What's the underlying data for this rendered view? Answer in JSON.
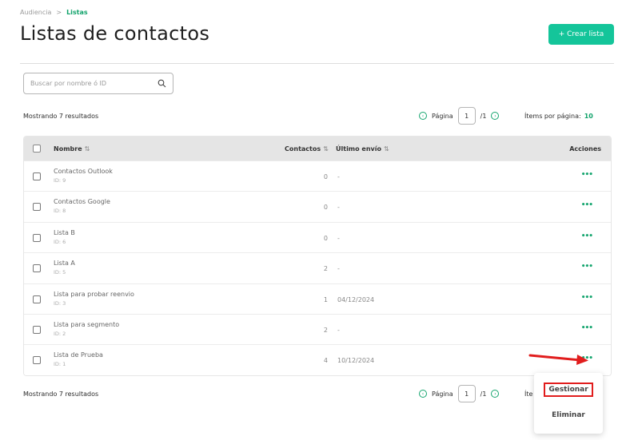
{
  "breadcrumb": {
    "parent": "Audiencia",
    "separator": ">",
    "current": "Listas"
  },
  "page_title": "Listas de contactos",
  "create_button": {
    "icon": "plus-icon",
    "label": "+  Crear lista"
  },
  "search": {
    "placeholder": "Buscar por nombre ó ID",
    "value": ""
  },
  "results_text": "Mostrando 7 resultados",
  "pagination": {
    "label": "Página",
    "current": "1",
    "total": "/1",
    "per_page_label": "Ítems por página:",
    "per_page": "10"
  },
  "table": {
    "columns": {
      "name": "Nombre",
      "contacts": "Contactos",
      "last_send": "Último envío",
      "actions": "Acciones",
      "sort_icon": "⇅"
    },
    "rows": [
      {
        "name": "Contactos Outlook",
        "id": "ID: 9",
        "contacts": "0",
        "last": "-"
      },
      {
        "name": "Contactos Google",
        "id": "ID: 8",
        "contacts": "0",
        "last": "-"
      },
      {
        "name": "Lista B",
        "id": "ID: 6",
        "contacts": "0",
        "last": "-"
      },
      {
        "name": "Lista A",
        "id": "ID: 5",
        "contacts": "2",
        "last": "-"
      },
      {
        "name": "Lista para probar reenvio",
        "id": "ID: 3",
        "contacts": "1",
        "last": "04/12/2024"
      },
      {
        "name": "Lista para segmento",
        "id": "ID: 2",
        "contacts": "2",
        "last": "-"
      },
      {
        "name": "Lista de Prueba",
        "id": "ID: 1",
        "contacts": "4",
        "last": "10/12/2024"
      }
    ],
    "actions_icon": "•••"
  },
  "bottom": {
    "results_text": "Mostrando 7 resultados",
    "page_label": "Página",
    "current": "1",
    "total": "/1",
    "per_page_partial": "Íte"
  },
  "menu": {
    "manage": "Gestionar",
    "delete": "Eliminar"
  },
  "colors": {
    "accent": "#14c59a",
    "highlight": "#e11d1d"
  }
}
